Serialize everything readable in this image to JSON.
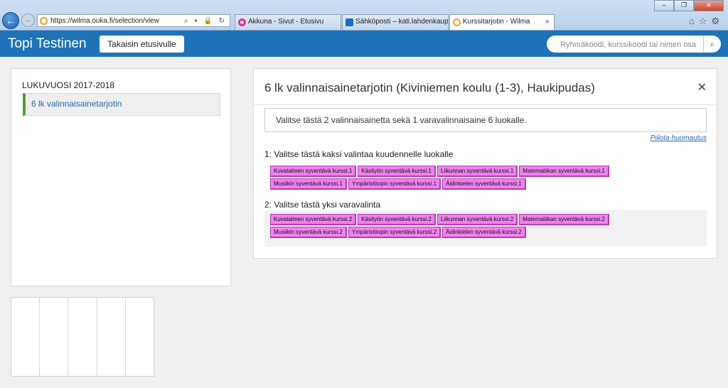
{
  "browser": {
    "window_title": "Kurssitarjotin - Wilma",
    "address": "https://wilma.ouka.fi/selection/view",
    "tabs": [
      {
        "label": "Akkuna - Sivut - Etusivu",
        "icon": "akkuna-icon"
      },
      {
        "label": "Sähköposti – kati.lahdenkaupp...",
        "icon": "outlook-icon"
      },
      {
        "label": "Kurssitarjotin - Wilma",
        "icon": "wilma-icon",
        "active": true
      }
    ]
  },
  "header": {
    "user_name": "Topi Testinen",
    "back_button": "Takaisin etusivulle",
    "search_placeholder": "Ryhmäkoodi, kurssikoodi tai nimen osa"
  },
  "sidebar": {
    "year_heading": "LUKUVUOSI 2017-2018",
    "items": [
      {
        "label": "6 lk valinnaisainetarjotin",
        "selected": true
      }
    ]
  },
  "main": {
    "title": "6 lk valinnaisainetarjotin (Kiviniemen koulu (1-3), Haukipudas)",
    "notice": "Valitse tästä 2 valinnaisainetta sekä 1 varavalinnaisaine 6 luokalle.",
    "hide_note_link": "Piilota huomautus",
    "groups": [
      {
        "title": "1: Valitse tästä kaksi valintaa kuudennelle luokalle",
        "rows": [
          [
            "Kuvataiteen syventävä kurssi.1",
            "Käsityön syventävä kurssi.1",
            "Liikunnan syventävä kurssi.1",
            "Matematiikan syventävä kurssi.1"
          ],
          [
            "Musiikin syventävä kurssi.1",
            "Ympäristöopin syventävä kurssi.1",
            "Äidinkielen syventävä kurssi.1"
          ]
        ]
      },
      {
        "title": "2: Valitse tästä yksi varavalinta",
        "rows": [
          [
            "Kuvataiteen syventävä kurssi.2",
            "Käsityön syventävä kurssi.2",
            "Liikunnan syventävä kurssi.2",
            "Matematiikan syventävä kurssi.2"
          ],
          [
            "Musiikin syventävä kurssi.2",
            "Ympäristöopin syventävä kurssi.2",
            "Äidinkielen syventävä kurssi.2"
          ]
        ]
      }
    ]
  },
  "colors": {
    "header_bg": "#1e73b8",
    "chip_bg": "#ee82ee",
    "selected_marker": "#57a02c",
    "link": "#2b6aa6"
  }
}
